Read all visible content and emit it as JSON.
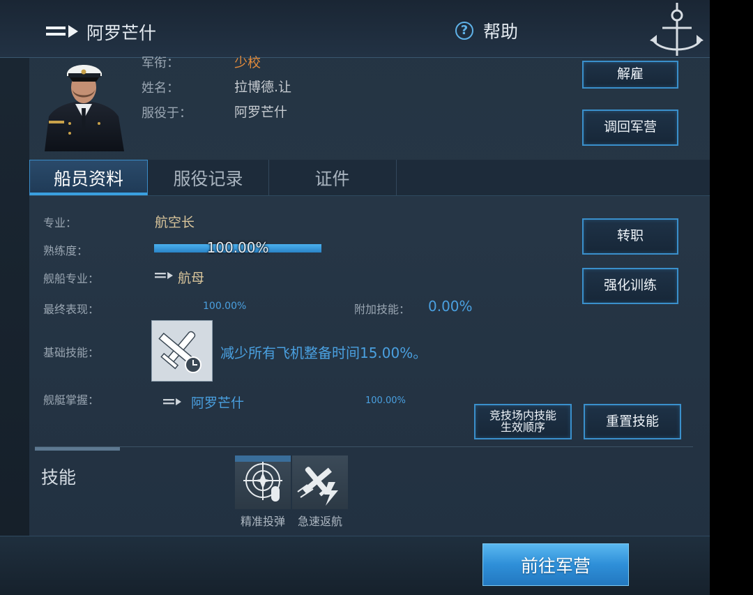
{
  "header": {
    "title": "阿罗芒什",
    "help_label": "帮助"
  },
  "officer": {
    "rank_label": "军衔：",
    "rank_value": "少校",
    "name_label": "姓名：",
    "name_value": "拉博德.让",
    "serve_label": "服役于：",
    "serve_value": "阿罗芒什"
  },
  "actions": {
    "dismiss": "解雇",
    "recall": "调回军营",
    "change_job": "转职",
    "train": "强化训练",
    "arena_order_line1": "竞技场内技能",
    "arena_order_line2": "生效顺序",
    "reset_skills": "重置技能",
    "go_barracks": "前往军营"
  },
  "tabs": [
    {
      "label": "船员资料",
      "active": true
    },
    {
      "label": "服役记录",
      "active": false
    },
    {
      "label": "证件",
      "active": false
    }
  ],
  "profile": {
    "specialty_label": "专业：",
    "specialty_value": "航空长",
    "proficiency_label": "熟练度：",
    "proficiency_text": "100.00%",
    "proficiency_fraction": 1.0,
    "ship_specialty_label": "舰船专业：",
    "ship_specialty_value": "航母",
    "final_perf_label": "最终表现：",
    "final_perf_value": "100.00%",
    "extra_skill_label": "附加技能：",
    "extra_skill_value": "0.00%",
    "base_skill_label": "基础技能：",
    "base_skill_desc": "减少所有飞机整备时间15.00%。",
    "mastery_label": "舰艇掌握：",
    "mastery_ship": "阿罗芒什",
    "mastery_value": "100.00%"
  },
  "skills": {
    "title": "技能",
    "items": [
      {
        "name": "精准投弹",
        "icon": "precision-bombing-icon"
      },
      {
        "name": "急速返航",
        "icon": "rapid-return-icon"
      }
    ]
  },
  "colors": {
    "accent_blue": "#3a90cc",
    "rank_orange": "#e08a3c",
    "value_gold": "#d9c59b",
    "highlight_blue": "#4aa0e0"
  }
}
